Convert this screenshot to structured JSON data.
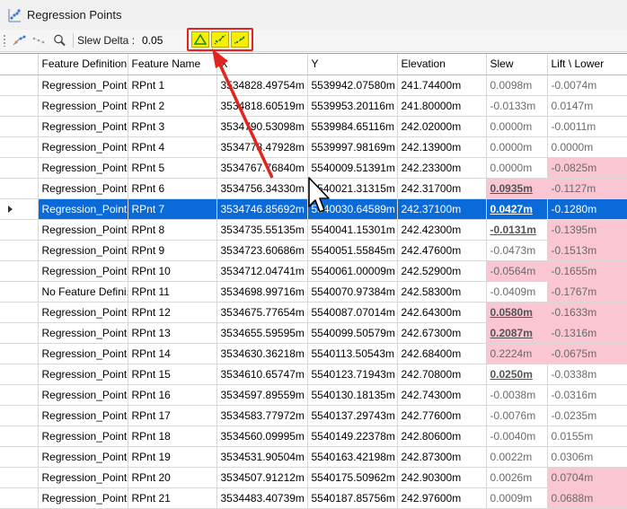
{
  "window": {
    "title": "Regression Points"
  },
  "toolbar": {
    "slew_label": "Slew Delta :",
    "slew_value": "0.05"
  },
  "columns": [
    "",
    "Feature Definition",
    "Feature Name",
    "X",
    "Y",
    "Elevation",
    "Slew",
    "Lift \\ Lower"
  ],
  "rows": [
    {
      "def": "Regression_Point",
      "name": "RPnt 1",
      "x": "3534828.49754m",
      "y": "5539942.07580m",
      "elev": "241.74400m",
      "slew": "0.0098m",
      "lift": "-0.0074m"
    },
    {
      "def": "Regression_Point",
      "name": "RPnt 2",
      "x": "3534818.60519m",
      "y": "5539953.20116m",
      "elev": "241.80000m",
      "slew": "-0.0133m",
      "lift": "0.0147m"
    },
    {
      "def": "Regression_Point",
      "name": "RPnt 3",
      "x": "3534790.53098m",
      "y": "5539984.65116m",
      "elev": "242.02000m",
      "slew": "0.0000m",
      "lift": "-0.0011m"
    },
    {
      "def": "Regression_Point",
      "name": "RPnt 4",
      "x": "3534778.47928m",
      "y": "5539997.98169m",
      "elev": "242.13900m",
      "slew": "0.0000m",
      "lift": "0.0000m"
    },
    {
      "def": "Regression_Point",
      "name": "RPnt 5",
      "x": "3534767.76840m",
      "y": "5540009.51391m",
      "elev": "242.23300m",
      "slew": "0.0000m",
      "lift": "-0.0825m"
    },
    {
      "def": "Regression_Point",
      "name": "RPnt 6",
      "x": "3534756.34330m",
      "y": "5540021.31315m",
      "elev": "242.31700m",
      "slew": "0.0935m",
      "lift": "-0.1127m"
    },
    {
      "def": "Regression_Point",
      "name": "RPnt 7",
      "x": "3534746.85692m",
      "y": "5540030.64589m",
      "elev": "242.37100m",
      "slew": "0.0427m",
      "lift": "-0.1280m"
    },
    {
      "def": "Regression_Point",
      "name": "RPnt 8",
      "x": "3534735.55135m",
      "y": "5540041.15301m",
      "elev": "242.42300m",
      "slew": "-0.0131m",
      "lift": "-0.1395m"
    },
    {
      "def": "Regression_Point",
      "name": "RPnt 9",
      "x": "3534723.60686m",
      "y": "5540051.55845m",
      "elev": "242.47600m",
      "slew": "-0.0473m",
      "lift": "-0.1513m"
    },
    {
      "def": "Regression_Point",
      "name": "RPnt 10",
      "x": "3534712.04741m",
      "y": "5540061.00009m",
      "elev": "242.52900m",
      "slew": "-0.0564m",
      "lift": "-0.1655m"
    },
    {
      "def": "No Feature Defini...",
      "name": "RPnt 11",
      "x": "3534698.99716m",
      "y": "5540070.97384m",
      "elev": "242.58300m",
      "slew": "-0.0409m",
      "lift": "-0.1767m"
    },
    {
      "def": "Regression_Point",
      "name": "RPnt 12",
      "x": "3534675.77654m",
      "y": "5540087.07014m",
      "elev": "242.64300m",
      "slew": "0.0580m",
      "lift": "-0.1633m"
    },
    {
      "def": "Regression_Point",
      "name": "RPnt 13",
      "x": "3534655.59595m",
      "y": "5540099.50579m",
      "elev": "242.67300m",
      "slew": "0.2087m",
      "lift": "-0.1316m"
    },
    {
      "def": "Regression_Point",
      "name": "RPnt 14",
      "x": "3534630.36218m",
      "y": "5540113.50543m",
      "elev": "242.68400m",
      "slew": "0.2224m",
      "lift": "-0.0675m"
    },
    {
      "def": "Regression_Point",
      "name": "RPnt 15",
      "x": "3534610.65747m",
      "y": "5540123.71943m",
      "elev": "242.70800m",
      "slew": "0.0250m",
      "lift": "-0.0338m"
    },
    {
      "def": "Regression_Point",
      "name": "RPnt 16",
      "x": "3534597.89559m",
      "y": "5540130.18135m",
      "elev": "242.74300m",
      "slew": "-0.0038m",
      "lift": "-0.0316m"
    },
    {
      "def": "Regression_Point",
      "name": "RPnt 17",
      "x": "3534583.77972m",
      "y": "5540137.29743m",
      "elev": "242.77600m",
      "slew": "-0.0076m",
      "lift": "-0.0235m"
    },
    {
      "def": "Regression_Point",
      "name": "RPnt 18",
      "x": "3534560.09995m",
      "y": "5540149.22378m",
      "elev": "242.80600m",
      "slew": "-0.0040m",
      "lift": "0.0155m"
    },
    {
      "def": "Regression_Point",
      "name": "RPnt 19",
      "x": "3534531.90504m",
      "y": "5540163.42198m",
      "elev": "242.87300m",
      "slew": "0.0022m",
      "lift": "0.0306m"
    },
    {
      "def": "Regression_Point",
      "name": "RPnt 20",
      "x": "3534507.91212m",
      "y": "5540175.50962m",
      "elev": "242.90300m",
      "slew": "0.0026m",
      "lift": "0.0704m"
    },
    {
      "def": "Regression_Point",
      "name": "RPnt 21",
      "x": "3534483.40739m",
      "y": "5540187.85756m",
      "elev": "242.97600m",
      "slew": "0.0009m",
      "lift": "0.0688m"
    }
  ],
  "styles": {
    "selected_row": 6,
    "slew_bold": [
      5,
      6,
      7,
      11,
      12,
      14
    ],
    "slew_pink": [
      5,
      9,
      11,
      12,
      13
    ],
    "lift_pink": [
      4,
      5,
      7,
      8,
      9,
      10,
      11,
      12,
      13,
      19,
      20
    ]
  },
  "colors": {
    "selection": "#0a6ad8",
    "highlight_pink": "#f9c6d2",
    "toolbar_yellow": "#f7ef00",
    "annotation_red": "#e4231f"
  }
}
